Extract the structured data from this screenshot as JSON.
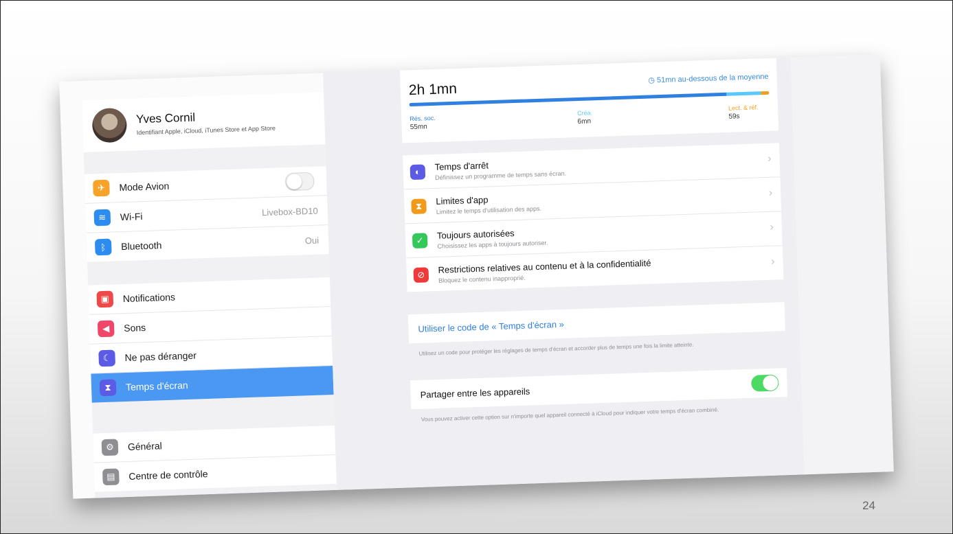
{
  "slide_number": "24",
  "profile": {
    "name": "Yves Cornil",
    "subtitle": "Identifiant Apple, iCloud, iTunes Store et App Store"
  },
  "sidebar": {
    "group1": [
      {
        "label": "Mode Avion",
        "icon": "airplane-icon",
        "color": "#f7a32a",
        "toggle": false
      },
      {
        "label": "Wi-Fi",
        "icon": "wifi-icon",
        "color": "#2d8cf0",
        "value": "Livebox-BD10"
      },
      {
        "label": "Bluetooth",
        "icon": "bluetooth-icon",
        "color": "#2d8cf0",
        "value": "Oui"
      }
    ],
    "group2": [
      {
        "label": "Notifications",
        "icon": "notifications-icon",
        "color": "#f04848"
      },
      {
        "label": "Sons",
        "icon": "speaker-icon",
        "color": "#f0466a"
      },
      {
        "label": "Ne pas déranger",
        "icon": "moon-icon",
        "color": "#5b5be6"
      },
      {
        "label": "Temps d'écran",
        "icon": "hourglass-icon",
        "color": "#5b5be6",
        "selected": true
      }
    ],
    "group3": [
      {
        "label": "Général",
        "icon": "gear-icon",
        "color": "#8e8e93"
      },
      {
        "label": "Centre de contrôle",
        "icon": "control-center-icon",
        "color": "#8e8e93"
      }
    ]
  },
  "usage": {
    "total": "2h 1mn",
    "average_note": "51mn au-dessous de la moyenne",
    "categories": [
      {
        "name": "Rés. soc.",
        "time": "55mn",
        "color": "#2f80e0"
      },
      {
        "name": "Créa.",
        "time": "6mn",
        "color": "#5ac8fa"
      },
      {
        "name": "Lect. & réf.",
        "time": "59s",
        "color": "#f0a020"
      }
    ]
  },
  "options": [
    {
      "title": "Temps d'arrêt",
      "subtitle": "Définissez un programme de temps sans écran.",
      "icon": "downtime-icon",
      "color": "#5b5be6"
    },
    {
      "title": "Limites d'app",
      "subtitle": "Limitez le temps d'utilisation des apps.",
      "icon": "hourglass-icon",
      "color": "#f29a1a"
    },
    {
      "title": "Toujours autorisées",
      "subtitle": "Choisissez les apps à toujours autoriser.",
      "icon": "checkmark-icon",
      "color": "#34c759"
    },
    {
      "title": "Restrictions relatives au contenu et à la confidentialité",
      "subtitle": "Bloquez le contenu inapproprié.",
      "icon": "restriction-icon",
      "color": "#f03a3a"
    }
  ],
  "passcode": {
    "label": "Utiliser le code de « Temps d'écran »"
  },
  "passcode_footer": "Utilisez un code pour protéger les réglages de temps d'écran et accorder plus de temps une fois la limite atteinte.",
  "share": {
    "label": "Partager entre les appareils",
    "enabled": true
  },
  "share_footer": "Vous pouvez activer cette option sur n'importe quel appareil connecté à iCloud pour indiquer votre temps d'écran combiné."
}
